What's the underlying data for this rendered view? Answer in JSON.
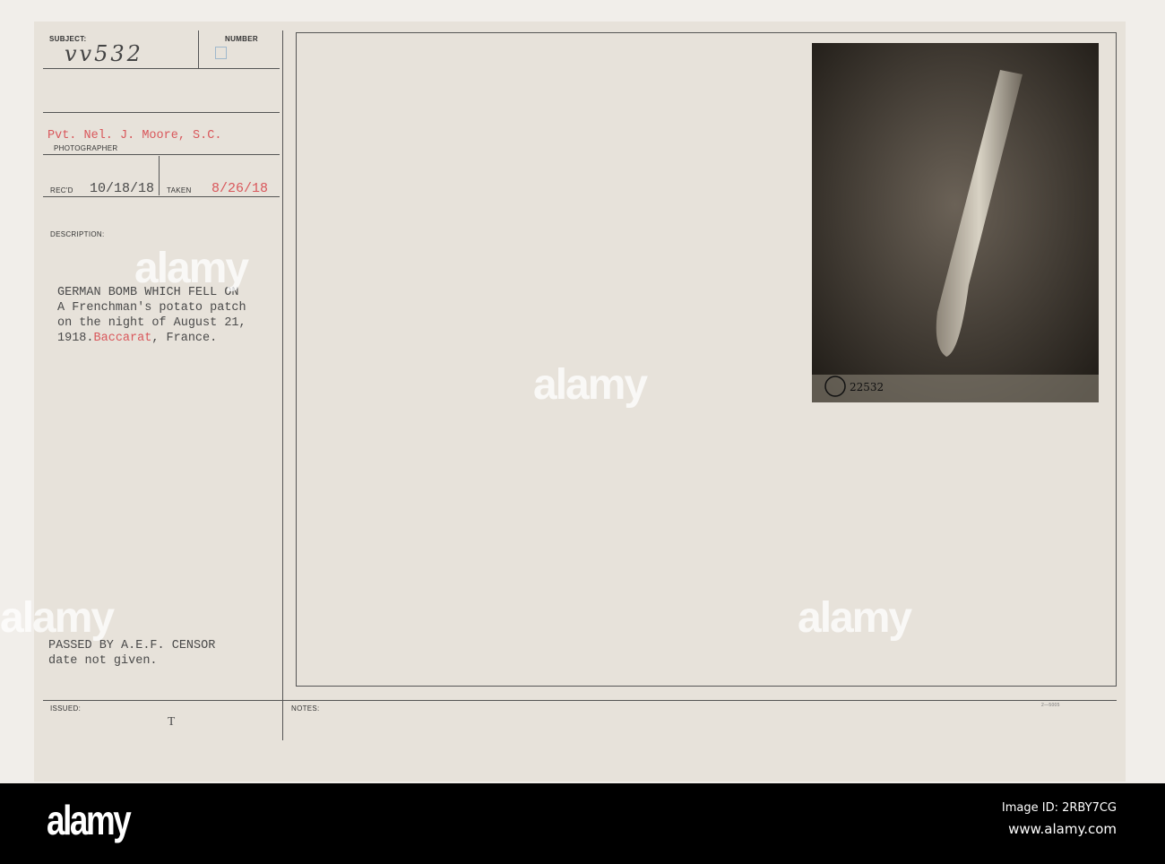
{
  "card": {
    "subject_label": "SUBJECT:",
    "number_label": "NUMBER",
    "subject_number": "vv532",
    "photographer": "Pvt. Nel. J. Moore, S.C.",
    "photographer_label": "PHOTOGRAPHER",
    "recd_label": "REC'D",
    "recd_date": "10/18/18",
    "taken_label": "TAKEN",
    "taken_date": "8/26/18",
    "description_label": "DESCRIPTION:",
    "description_lines": [
      "GERMAN BOMB WHICH FELL ON",
      "A Frenchman's potato patch",
      "on the night of August 21,"
    ],
    "description_last_prefix": "1918.",
    "description_place": "Baccarat",
    "description_last_suffix": ", France.",
    "censor_line1": "PASSED BY A.E.F. CENSOR",
    "censor_line2": "date not given.",
    "issued_label": "ISSUED:",
    "issued_mark": "T",
    "notes_label": "NOTES:",
    "form_number": "2—5005",
    "photo_number": "22532",
    "accent_red": "#d9575b"
  },
  "watermark": "alamy",
  "footer": {
    "logo": "alamy",
    "image_id": "Image ID: 2RBY7CG",
    "site": "www.alamy.com"
  }
}
